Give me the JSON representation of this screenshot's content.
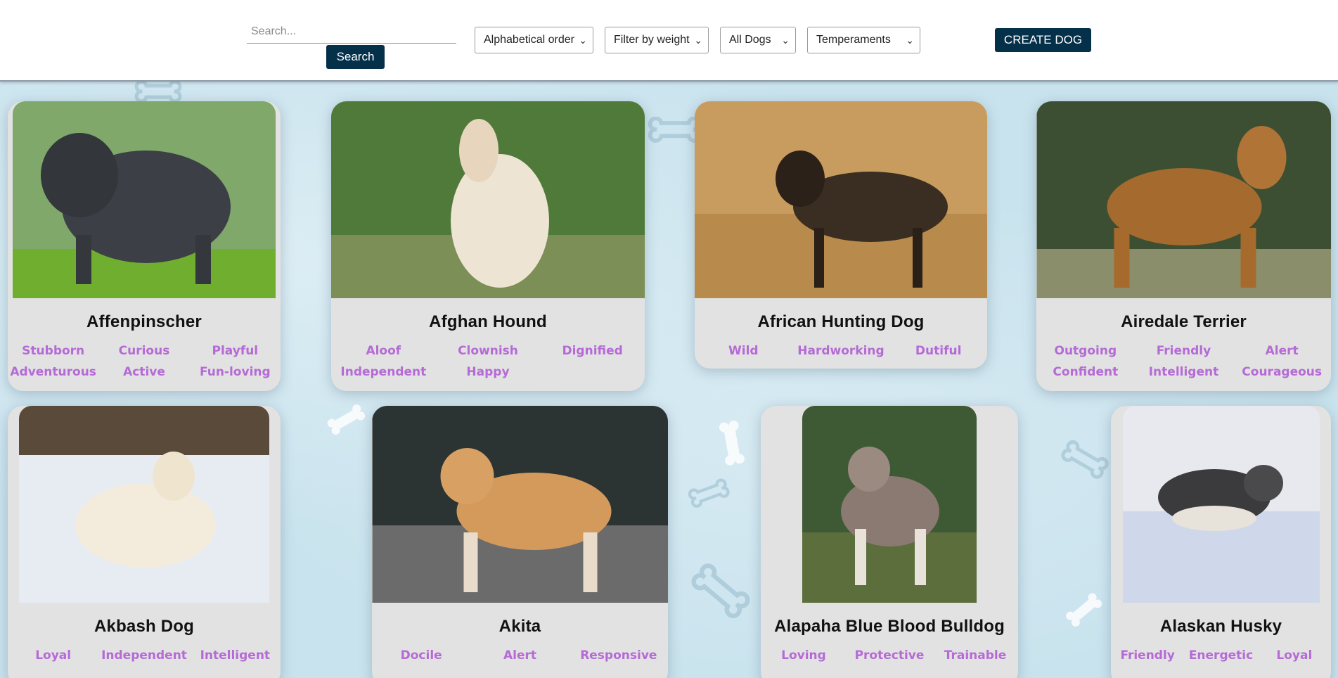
{
  "search": {
    "placeholder": "Search...",
    "button_label": "Search"
  },
  "filters": {
    "order": "Alphabetical order",
    "weight": "Filter by weight",
    "origin": "All Dogs",
    "temperaments": "Temperaments"
  },
  "create_button_label": "CREATE DOG",
  "dogs": [
    {
      "name": "Affenpinscher",
      "temperaments": [
        "Stubborn",
        "Curious",
        "Playful",
        "Adventurous",
        "Active",
        "Fun-loving"
      ]
    },
    {
      "name": "Afghan Hound",
      "temperaments": [
        "Aloof",
        "Clownish",
        "Dignified",
        "Independent",
        "Happy"
      ]
    },
    {
      "name": "African Hunting Dog",
      "temperaments": [
        "Wild",
        "Hardworking",
        "Dutiful"
      ]
    },
    {
      "name": "Airedale Terrier",
      "temperaments": [
        "Outgoing",
        "Friendly",
        "Alert",
        "Confident",
        "Intelligent",
        "Courageous"
      ]
    },
    {
      "name": "Akbash Dog",
      "temperaments": [
        "Loyal",
        "Independent",
        "Intelligent"
      ]
    },
    {
      "name": "Akita",
      "temperaments": [
        "Docile",
        "Alert",
        "Responsive"
      ]
    },
    {
      "name": "Alapaha Blue Blood Bulldog",
      "temperaments": [
        "Loving",
        "Protective",
        "Trainable"
      ]
    },
    {
      "name": "Alaskan Husky",
      "temperaments": [
        "Friendly",
        "Energetic",
        "Loyal"
      ]
    }
  ],
  "icons": {
    "chevron": "chevron-down-icon",
    "background": "bone-icon"
  },
  "colors": {
    "accent_button": "#05304a",
    "temperament_text": "#b56ad6",
    "card_background": "#e2e2e2",
    "page_background": "#c9e3ee"
  }
}
